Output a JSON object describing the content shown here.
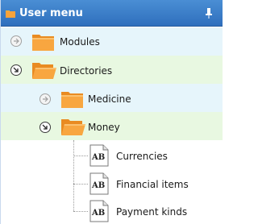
{
  "header": {
    "title": "User menu",
    "icon": "folder-icon",
    "pin_icon": "pin-icon"
  },
  "colors": {
    "header": "#3a7ec8",
    "row_light": "#e6f5fb",
    "row_green": "#e8f8e1",
    "folder": "#f7a33b"
  },
  "tree": {
    "modules": {
      "label": "Modules",
      "state": "collapsed"
    },
    "directories": {
      "label": "Directories",
      "state": "expanded"
    },
    "medicine": {
      "label": "Medicine",
      "state": "collapsed"
    },
    "money": {
      "label": "Money",
      "state": "expanded"
    },
    "currencies": {
      "label": "Currencies",
      "icon_text": "AB"
    },
    "financial_items": {
      "label": "Financial items",
      "icon_text": "AB"
    },
    "payment_kinds": {
      "label": "Payment kinds",
      "icon_text": "AB"
    }
  }
}
